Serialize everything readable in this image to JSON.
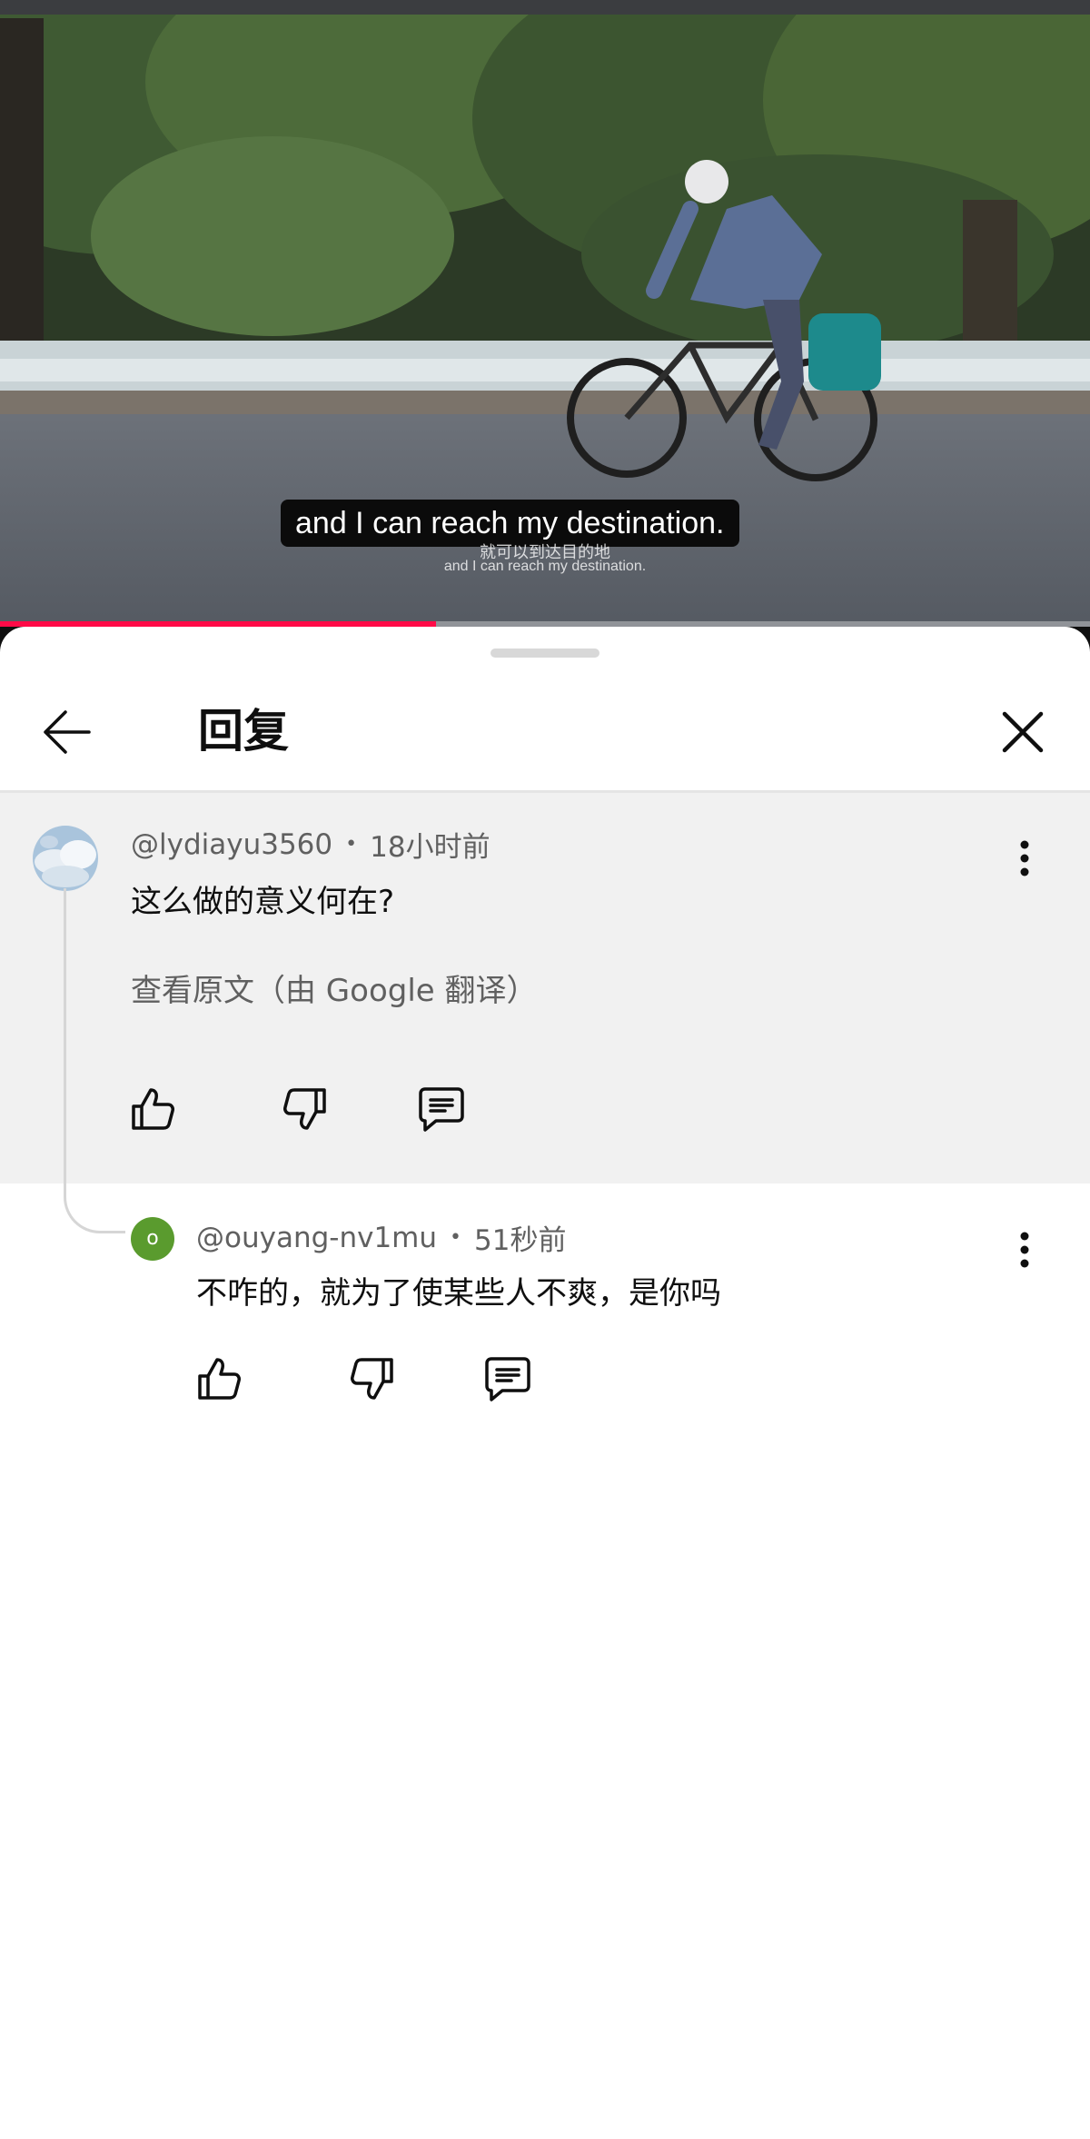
{
  "video": {
    "subtitle": "and I can reach my destination.",
    "burned_subtitle_cn": "就可以到达目的地",
    "burned_subtitle_en": "and I can reach my destination.",
    "progress": 0.4,
    "progress_color": "#ff0a47"
  },
  "sheet": {
    "title": "回复"
  },
  "parent_comment": {
    "author": "@lydiayu3560",
    "time": "18小时前",
    "text": "这么做的意义何在?",
    "translate_link": "查看原文（由 Google 翻译）"
  },
  "reply": {
    "avatar_letter": "o",
    "avatar_color": "#5a9b2e",
    "author": "@ouyang-nv1mu",
    "time": "51秒前",
    "text": "不咋的，就为了使某些人不爽，是你吗"
  },
  "icons": {
    "back": "arrow-left-icon",
    "close": "close-icon",
    "more": "more-vertical-icon",
    "like": "thumb-up-icon",
    "dislike": "thumb-down-icon",
    "reply": "comment-icon"
  }
}
